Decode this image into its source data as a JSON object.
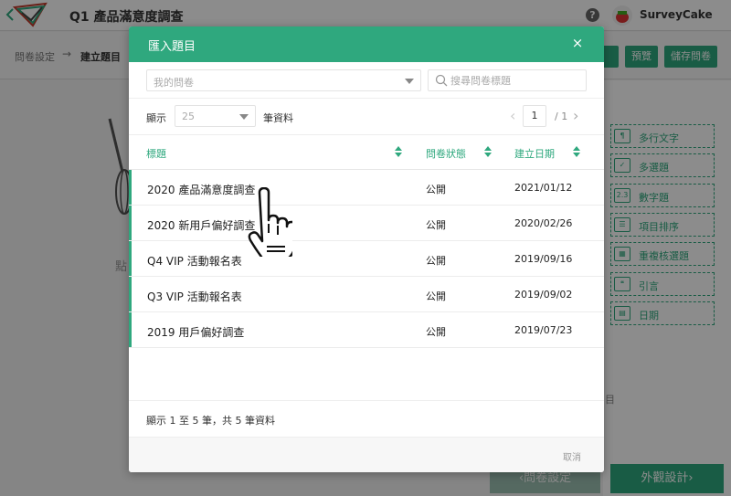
{
  "app": {
    "title": "Q1 產品滿意度調查",
    "help_icon": "?",
    "user_name": "SurveyCake"
  },
  "breadcrumb": {
    "step1": "問卷設定",
    "arrow": "→",
    "step2": "建立題目"
  },
  "toolbar": {
    "preview_label": "預覽",
    "save_label": "儲存問卷"
  },
  "question_types": [
    {
      "label": "多行文字",
      "icon": "textarea-icon",
      "glyph": "¶"
    },
    {
      "label": "多選題",
      "icon": "checkbox-icon",
      "glyph": "✓"
    },
    {
      "label": "數字題",
      "icon": "number-icon",
      "glyph": "2.3"
    },
    {
      "label": "項目排序",
      "icon": "list-order-icon",
      "glyph": "☰"
    },
    {
      "label": "重複核選題",
      "icon": "matrix-icon",
      "glyph": "▦"
    },
    {
      "label": "引言",
      "icon": "quote-icon",
      "glyph": "❝"
    },
    {
      "label": "日期",
      "icon": "calendar-icon",
      "glyph": "▤"
    }
  ],
  "canvas": {
    "ghost_text": "點",
    "side_hint": "目"
  },
  "footer": {
    "prev_label": "‹問卷設定",
    "next_label": "外觀設計›"
  },
  "modal": {
    "title": "匯入題目",
    "close_glyph": "×",
    "source_select": "我的問卷",
    "search_placeholder": "搜尋問卷標題",
    "show_label": "顯示",
    "page_size": "25",
    "records_label": "筆資料",
    "current_page": "1",
    "total_pages": "/ 1",
    "prev_glyph": "‹",
    "next_glyph": "›",
    "columns": {
      "title": "標題",
      "status": "問卷狀態",
      "created": "建立日期"
    },
    "rows": [
      {
        "title": "2020 產品滿意度調查",
        "status": "公開",
        "date": "2021/01/12"
      },
      {
        "title": "2020 新用戶偏好調查",
        "status": "公開",
        "date": "2020/02/26"
      },
      {
        "title": "Q4 VIP 活動報名表",
        "status": "公開",
        "date": "2019/09/16"
      },
      {
        "title": "Q3 VIP 活動報名表",
        "status": "公開",
        "date": "2019/09/02"
      },
      {
        "title": "2019 用戶偏好調查",
        "status": "公開",
        "date": "2019/07/23"
      }
    ],
    "summary": "顯示 1 至 5 筆，共 5 筆資料",
    "cancel_label": "取消"
  },
  "colors": {
    "brand": "#2fa87e",
    "overlay": "rgba(0,0,0,0.45)"
  }
}
